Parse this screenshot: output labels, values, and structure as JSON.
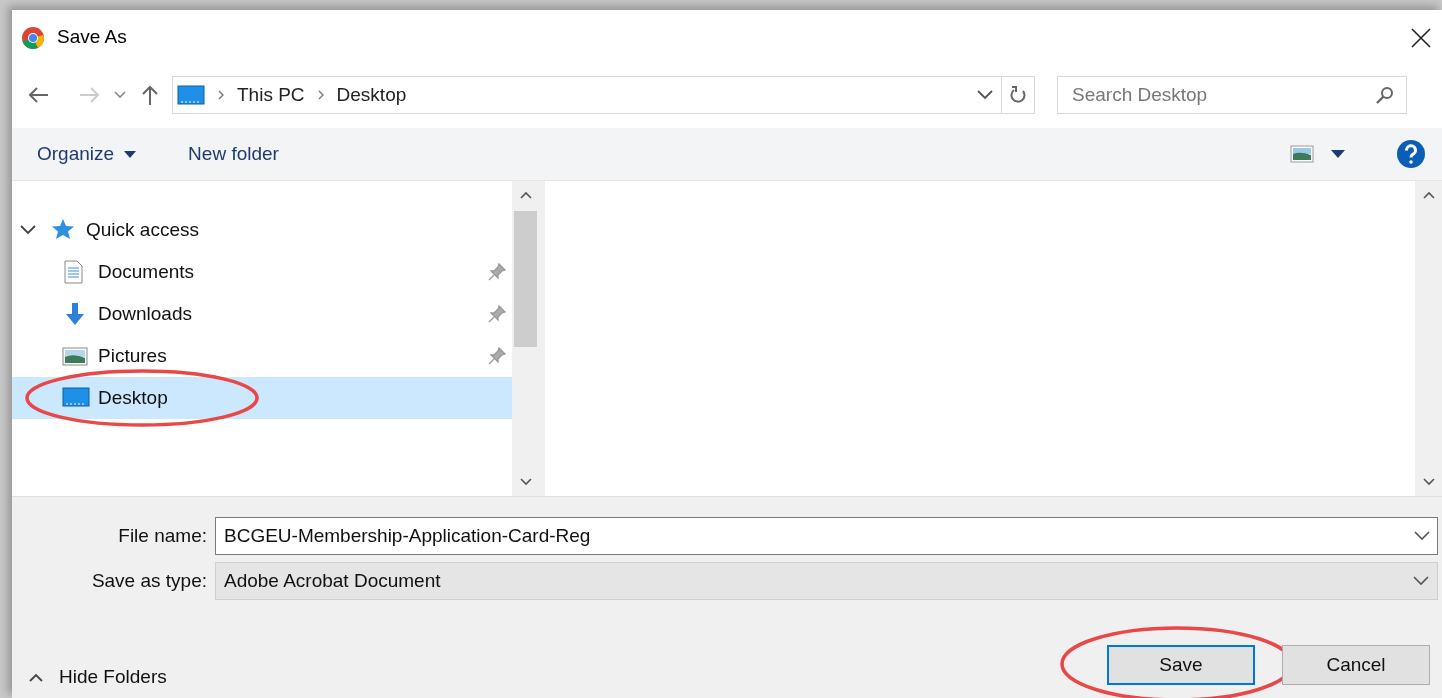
{
  "window": {
    "title": "Save As"
  },
  "address_bar": {
    "path": [
      "This PC",
      "Desktop"
    ],
    "search_placeholder": "Search Desktop"
  },
  "toolbar": {
    "items": [
      "Organize",
      "New folder"
    ]
  },
  "navigation": [
    {
      "label": "Quick access",
      "kind": "quick",
      "expanded": true,
      "selected": false,
      "pinned": false,
      "circled": false,
      "children": [
        {
          "label": "Documents",
          "kind": "documents",
          "selected": false,
          "pinned": true,
          "circled": false
        },
        {
          "label": "Downloads",
          "kind": "downloads",
          "selected": false,
          "pinned": true,
          "circled": false
        },
        {
          "label": "Pictures",
          "kind": "pictures",
          "selected": false,
          "pinned": true,
          "circled": false
        },
        {
          "label": "Desktop",
          "kind": "desktop",
          "selected": true,
          "pinned": false,
          "circled": true
        }
      ]
    }
  ],
  "fields": [
    {
      "label": "File name:",
      "value": "BCGEU-Membership-Application-Card-Reg",
      "editable": true
    },
    {
      "label": "Save as type:",
      "value": "Adobe Acrobat Document",
      "editable": false
    }
  ],
  "hide_folders": "Hide Folders",
  "buttons": [
    {
      "label": "Save",
      "default": true,
      "circled": true
    },
    {
      "label": "Cancel",
      "default": false,
      "circled": false
    }
  ]
}
